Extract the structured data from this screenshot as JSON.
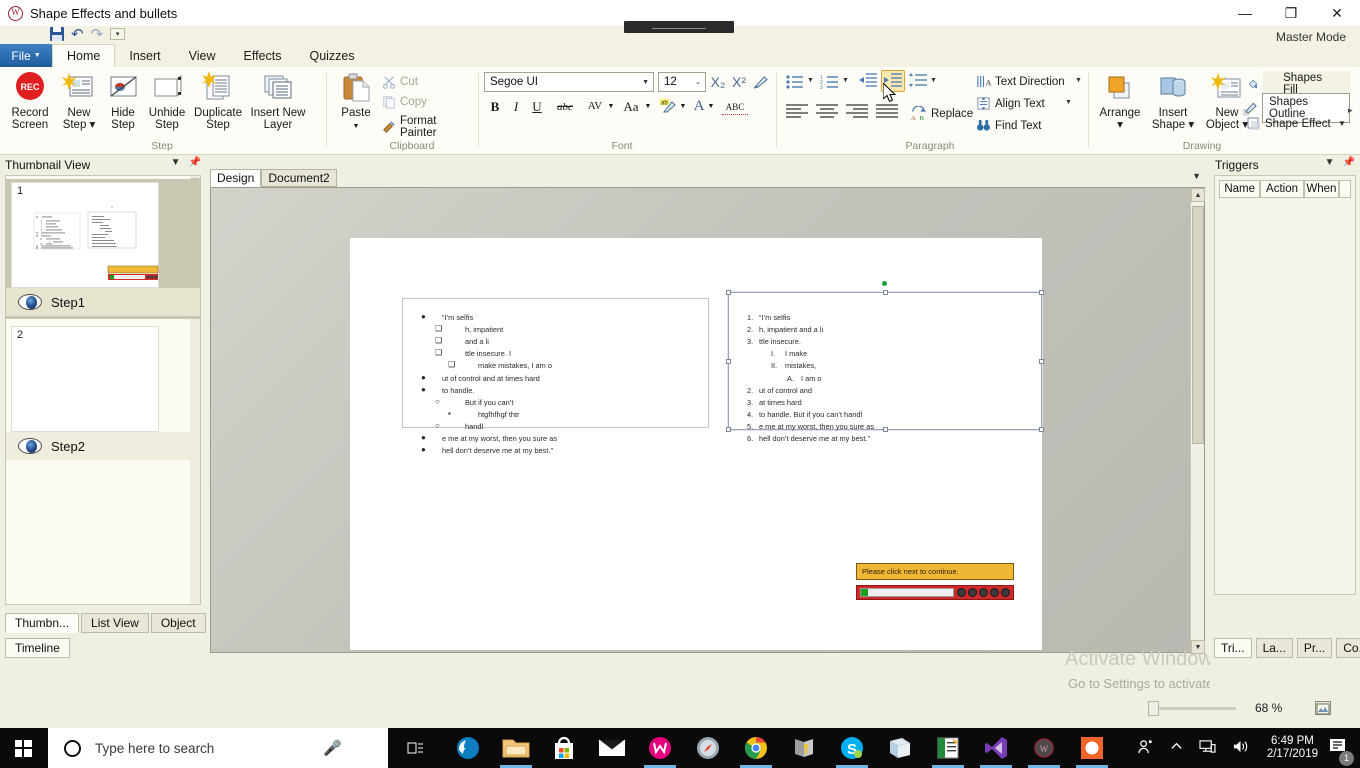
{
  "window": {
    "title": "Shape Effects and bullets",
    "logo_icon": "app-logo-icon",
    "minimize": "—",
    "maximize": "❐",
    "close": "✕",
    "master_mode": "Master Mode"
  },
  "quick_access": {
    "save": "save-icon",
    "undo": "↶",
    "redo": "↷",
    "customize": "▾"
  },
  "ribbon": {
    "file_tab": "File",
    "tabs": [
      "Home",
      "Insert",
      "View",
      "Effects",
      "Quizzes"
    ],
    "active_tab": "Home",
    "groups": [
      {
        "name": "Step",
        "buttons": [
          {
            "label": "Record\nScreen",
            "icon": "record-screen-icon"
          },
          {
            "label": "New\nStep ▾",
            "icon": "new-step-icon"
          },
          {
            "label": "Hide\nStep",
            "icon": "hide-step-icon"
          },
          {
            "label": "Unhide\nStep",
            "icon": "unhide-step-icon"
          },
          {
            "label": "Duplicate\nStep",
            "icon": "duplicate-step-icon"
          },
          {
            "label": "Insert New\nLayer",
            "icon": "insert-new-layer-icon"
          }
        ]
      },
      {
        "name": "Clipboard",
        "paste": "Paste",
        "items": [
          {
            "label": "Cut",
            "icon": "scissors-icon",
            "enabled": false
          },
          {
            "label": "Copy",
            "icon": "copy-icon",
            "enabled": false
          },
          {
            "label": "Format Painter",
            "icon": "format-painter-icon",
            "enabled": true
          }
        ]
      },
      {
        "name": "Font",
        "font_family": "Segoe UI",
        "font_size": "12",
        "subscript": "X₂",
        "superscript": "X²",
        "clear_formatting": "clear-formatting-icon",
        "bold": "B",
        "italic": "I",
        "underline": "U",
        "strikethrough": "abc",
        "char_spacing": "AV",
        "change_case": "Aa",
        "highlight": "text-highlight-icon",
        "font_color": "A",
        "spelling": "ABC"
      },
      {
        "name": "Paragraph",
        "bullets": "bullet-list-icon",
        "numbering": "numbered-list-icon",
        "decrease_indent": "decrease-indent-icon",
        "increase_indent": "increase-indent-icon",
        "line_spacing": "line-spacing-icon",
        "align_left": "align-left-icon",
        "align_center": "align-center-icon",
        "align_right": "align-right-icon",
        "justify": "justify-icon",
        "replace": "Replace",
        "text_direction": "Text Direction",
        "align_text": "Align Text",
        "find_text": "Find Text",
        "selected_button": "increase-indent-icon"
      },
      {
        "name": "Drawing",
        "buttons": [
          {
            "label": "Arrange\n▾",
            "icon": "arrange-icon"
          },
          {
            "label": "Insert\nShape ▾",
            "icon": "insert-shape-icon"
          },
          {
            "label": "New\nObject ▾",
            "icon": "new-object-icon"
          }
        ],
        "items": [
          {
            "label": "Shapes Fill",
            "icon": "shapes-fill-icon"
          },
          {
            "label": "Shapes Outline",
            "icon": "shapes-outline-icon"
          },
          {
            "label": "Shape Effect",
            "icon": "shape-effect-icon"
          }
        ],
        "expand": "▸"
      }
    ]
  },
  "left_panel": {
    "title": "Thumbnail View",
    "collapse_icon": "chevron-down-icon",
    "pin_icon": "pin-icon",
    "thumbnails": [
      {
        "number": "1",
        "label": "Step1",
        "selected": true,
        "visibility_icon": "eye-icon"
      },
      {
        "number": "2",
        "label": "Step2",
        "selected": false,
        "visibility_icon": "eye-icon"
      }
    ],
    "tabs_row1": [
      "Thumbn...",
      "List View",
      "Object"
    ],
    "tabs_row1_active": "Thumbn...",
    "tabs_row2": [
      "Timeline"
    ]
  },
  "center": {
    "doc_tabs": [
      "Design",
      "Document2"
    ],
    "doc_tabs_active": "Design",
    "tabs_overflow_icon": "chevron-down-icon",
    "textbox_left": {
      "lines": [
        {
          "marker": "●",
          "text": "“I’m selfis",
          "indent": 0
        },
        {
          "marker": "❑",
          "text": "h, impatient",
          "indent": 1
        },
        {
          "marker": "❑",
          "text": "and a li",
          "indent": 1
        },
        {
          "marker": "❑",
          "text": "ttle insecure. I",
          "indent": 1
        },
        {
          "marker": "❑",
          "text": "make mistakes, I am o",
          "indent": 2
        },
        {
          "marker": "●",
          "text": "ut of control and at times hard",
          "indent": 0
        },
        {
          "marker": "●",
          "text": "to handle.",
          "indent": 0
        },
        {
          "marker": "○",
          "text": "But if you can’t",
          "indent": 1
        },
        {
          "marker": "▪",
          "text": "htgfhfhgf thtr",
          "indent": 2
        },
        {
          "marker": "○",
          "text": "handl",
          "indent": 1
        },
        {
          "marker": "●",
          "text": "e me at my worst, then you sure as",
          "indent": 0
        },
        {
          "marker": "●",
          "text": "hell don’t deserve me at my best.”",
          "indent": 0
        }
      ]
    },
    "textbox_right": {
      "selected": true,
      "lines": [
        {
          "marker": "1.",
          "text": "“I’m selfis",
          "indent": 0
        },
        {
          "marker": "2.",
          "text": "h, impatient and a li",
          "indent": 0
        },
        {
          "marker": "3.",
          "text": "ttle insecure.",
          "indent": 0
        },
        {
          "marker": "I.",
          "text": "I make",
          "indent": 1
        },
        {
          "marker": "II.",
          "text": "mistakes,",
          "indent": 1
        },
        {
          "marker": "A.",
          "text": "I am o",
          "indent": 2
        },
        {
          "marker": "2.",
          "text": "ut of control and",
          "indent": 0
        },
        {
          "marker": "3.",
          "text": "at times hard",
          "indent": 0
        },
        {
          "marker": "4.",
          "text": "to handle. But if you can’t handl",
          "indent": 0
        },
        {
          "marker": "5.",
          "text": "e me at my worst, then you sure as",
          "indent": 0
        },
        {
          "marker": "6.",
          "text": "hell don’t deserve me at my best.”",
          "indent": 0
        }
      ]
    },
    "alert_text": "Please click next to continue.",
    "player": {
      "progress_percent": 8,
      "buttons": [
        "prev-icon",
        "play-icon",
        "pause-icon",
        "replay-icon",
        "next-icon"
      ]
    }
  },
  "right_panel": {
    "title": "Triggers",
    "collapse_icon": "chevron-down-icon",
    "pin_icon": "pin-icon",
    "columns": [
      "Name",
      "Action",
      "When"
    ],
    "tabs": [
      "Tri...",
      "La...",
      "Pr...",
      "Co..."
    ],
    "tabs_active": "Tri..."
  },
  "activation_watermark": {
    "line1": "Activate Windows",
    "line2": "Go to Settings to activate Windows."
  },
  "status_bar": {
    "zoom_value": "68 %",
    "fit_icon": "fit-to-window-icon"
  },
  "taskbar": {
    "start_icon": "windows-start-icon",
    "search_placeholder": "Type here to search",
    "search_icon": "search-circle-icon",
    "mic_icon": "microphone-icon",
    "task_view_icon": "task-view-icon",
    "apps": [
      {
        "name": "edge-icon",
        "running": false
      },
      {
        "name": "file-explorer-icon",
        "running": true
      },
      {
        "name": "microsoft-store-icon",
        "running": false
      },
      {
        "name": "mail-icon",
        "running": false
      },
      {
        "name": "wondershare-icon",
        "running": true
      },
      {
        "name": "safari-icon",
        "running": false
      },
      {
        "name": "chrome-icon",
        "running": true
      },
      {
        "name": "bandicam-icon",
        "running": false
      },
      {
        "name": "skype-icon",
        "running": true
      },
      {
        "name": "notes-icon",
        "running": false
      },
      {
        "name": "excel-icon",
        "running": true
      },
      {
        "name": "visual-studio-icon",
        "running": true
      },
      {
        "name": "app-logo-icon",
        "running": true
      },
      {
        "name": "activepresenter-icon",
        "running": true
      }
    ],
    "people_icon": "people-icon",
    "show_hidden_icon": "chevron-up-icon",
    "network_icon": "network-icon",
    "volume_icon": "volume-icon",
    "time": "6:49 PM",
    "date": "2/17/2019",
    "notifications_icon": "notifications-icon",
    "notifications_count": "1"
  },
  "colors": {
    "ribbon_bg": "#fdfcf6",
    "chrome_bg": "#f0efe4",
    "file_tab": "#2b6cb0",
    "selected_highlight": "#fde9b0",
    "alert_bg": "#f0b737",
    "player_bg": "#cf2a2a",
    "progress_fill": "#17a01c"
  }
}
